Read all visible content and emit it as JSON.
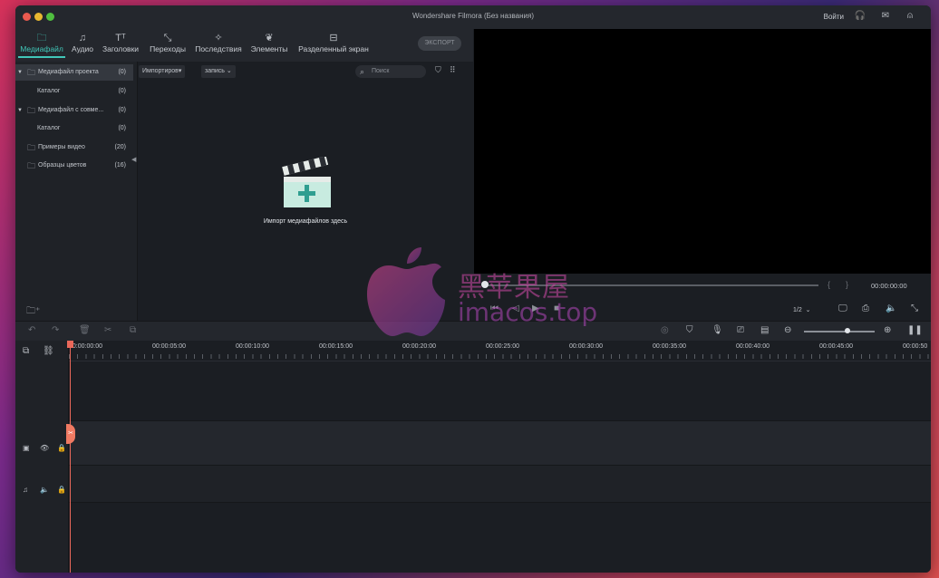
{
  "window": {
    "title": "Wondershare Filmora (Без названия)",
    "login": "Войти"
  },
  "toolbar": {
    "tabs": [
      {
        "label": "Медиафайл",
        "icon": "folder-icon"
      },
      {
        "label": "Аудио",
        "icon": "music-icon"
      },
      {
        "label": "Заголовки",
        "icon": "text-icon"
      },
      {
        "label": "Переходы",
        "icon": "transition-icon"
      },
      {
        "label": "Последствия",
        "icon": "effects-icon"
      },
      {
        "label": "Элементы",
        "icon": "elements-icon"
      },
      {
        "label": "Разделенный экран",
        "icon": "split-screen-icon"
      }
    ],
    "export_label": "ЭКСПОРТ"
  },
  "sidebar": {
    "items": [
      {
        "label": "Медиафайл проекта",
        "count": "(0)"
      },
      {
        "label": "Каталог",
        "count": "(0)"
      },
      {
        "label": "Медиафайл с совме...",
        "count": "(0)"
      },
      {
        "label": "Каталог",
        "count": "(0)"
      },
      {
        "label": "Примеры видео",
        "count": "(20)"
      },
      {
        "label": "Образцы цветов",
        "count": "(16)"
      }
    ]
  },
  "media": {
    "import_dropdown": "Импортиров",
    "record_dropdown": "запись",
    "search_placeholder": "Поиск",
    "import_hint": "Импорт медиафайлов здесь"
  },
  "preview": {
    "timecode": "00:00:00:00",
    "ratio": "1/2",
    "progress": 0
  },
  "timeline": {
    "ruler": [
      "00:00:00:00",
      "00:00:05:00",
      "00:00:10:00",
      "00:00:15:00",
      "00:00:20:00",
      "00:00:25:00",
      "00:00:30:00",
      "00:00:35:00",
      "00:00:40:00",
      "00:00:45:00",
      "00:00:50"
    ]
  },
  "watermark": {
    "cn": "黑苹果屋",
    "en": "imacos.top"
  },
  "colors": {
    "accent": "#41c7b9",
    "playhead": "#e9685a",
    "window_bg": "#1b1e23"
  }
}
